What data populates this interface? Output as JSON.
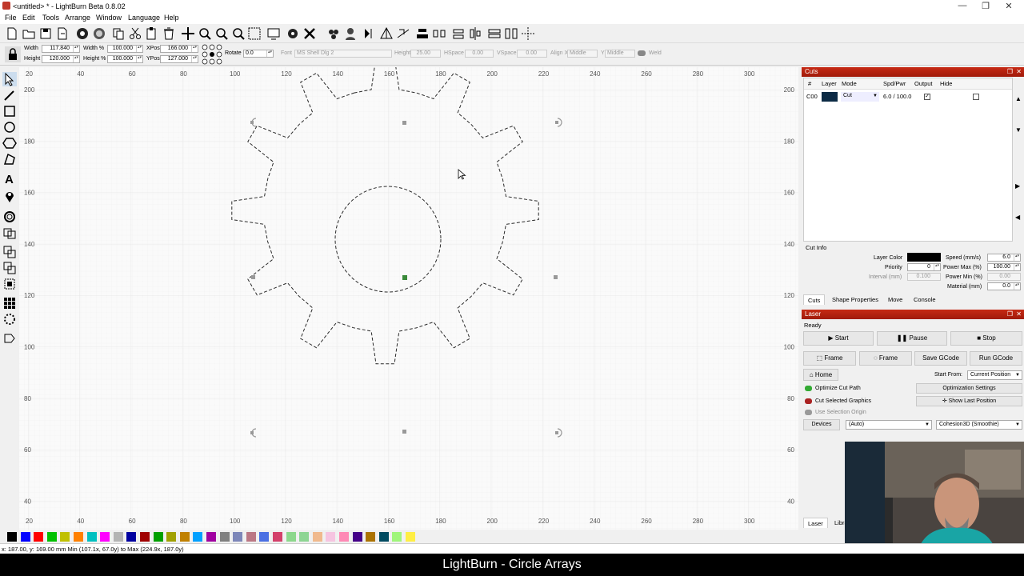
{
  "window": {
    "title": "<untitled> * - LightBurn Beta 0.8.02",
    "controls": [
      "—",
      "❐",
      "✕"
    ]
  },
  "menu": [
    "File",
    "Edit",
    "Tools",
    "Arrange",
    "Window",
    "Language",
    "Help"
  ],
  "props": {
    "width_label": "Width",
    "width_value": "117.840",
    "height_label": "Height",
    "height_value": "120.000",
    "width_pct_label": "Width %",
    "width_pct_value": "100.000",
    "height_pct_label": "Height %",
    "height_pct_value": "100.000",
    "xpos_label": "XPos",
    "xpos_value": "166.000",
    "ypos_label": "YPos",
    "ypos_value": "127.000",
    "rotate_label": "Rotate",
    "rotate_value": "0.0",
    "font_label": "Font",
    "font_value": "MS Shell Dlg 2",
    "fheight_label": "Height",
    "fheight_value": "25.00",
    "hspace_label": "HSpace",
    "hspace_value": "0.00",
    "vspace_label": "VSpace",
    "vspace_value": "0.00",
    "alignx_label": "Align X",
    "alignx_value": "Middle",
    "aligny_label": "Y",
    "aligny_value": "Middle",
    "weld_label": "Weld"
  },
  "ruler": {
    "top": [
      "20",
      "40",
      "60",
      "80",
      "100",
      "120",
      "140",
      "160",
      "180",
      "200",
      "220",
      "240",
      "260",
      "280",
      "300"
    ],
    "left": [
      "200",
      "180",
      "160",
      "140",
      "120",
      "100",
      "80",
      "60",
      "40"
    ]
  },
  "palette": [
    "#000000",
    "#0000ff",
    "#ff0000",
    "#00c000",
    "#c0c000",
    "#ff8000",
    "#00c0c0",
    "#ff00ff",
    "#b4b4b4",
    "#0000a0",
    "#a00000",
    "#00a000",
    "#a0a000",
    "#c08000",
    "#00a0ff",
    "#a000a0",
    "#808080",
    "#7d87b9",
    "#bb7784",
    "#4a6fe3",
    "#d33f6a",
    "#8cd78c",
    "#8dd593",
    "#f0b98d",
    "#f6c4e1",
    "#fe89b5",
    "#440088",
    "#ab7200",
    "#004a60",
    "#9ff57a",
    "#ffee44"
  ],
  "cuts": {
    "title": "Cuts",
    "headers": [
      "#",
      "Layer",
      "Mode",
      "Spd/Pwr",
      "Output",
      "Hide"
    ],
    "row": {
      "num": "C00",
      "color": "#0c2a44",
      "mode": "Cut",
      "spdpwr": "6.0 / 100.0"
    },
    "cut_info": "Cut Info",
    "layer_color_label": "Layer Color",
    "speed_label": "Speed (mm/s)",
    "speed_value": "6.0",
    "priority_label": "Priority",
    "priority_value": "0",
    "powermax_label": "Power Max (%)",
    "powermax_value": "100.00",
    "interval_label": "Interval (mm)",
    "interval_value": "0.100",
    "powermin_label": "Power Min (%)",
    "powermin_value": "0.00",
    "material_label": "Material (mm)",
    "material_value": "0.0",
    "tabs": [
      "Cuts",
      "Shape Properties",
      "Move",
      "Console"
    ]
  },
  "laser": {
    "title": "Laser",
    "status": "Ready",
    "start": "Start",
    "pause": "Pause",
    "stop": "Stop",
    "frame1": "Frame",
    "frame2": "Frame",
    "save_gcode": "Save GCode",
    "run_gcode": "Run GCode",
    "home": "Home",
    "start_from_label": "Start From:",
    "start_from_value": "Current Position",
    "optimize_cut_path": "Optimize Cut Path",
    "optimization_settings": "Optimization Settings",
    "cut_selected": "Cut Selected Graphics",
    "show_last_position": "Show Last Position",
    "use_selection_origin": "Use Selection Origin",
    "devices": "Devices",
    "devices_value": "(Auto)",
    "device_name": "Cohesion3D (Smoothie)",
    "tabs": [
      "Laser",
      "Libra"
    ]
  },
  "status_text": "x: 187.00, y: 169.00 mm   Min (107.1x, 67.0y) to Max (224.9x, 187.0y)",
  "caption": "LightBurn - Circle Arrays"
}
